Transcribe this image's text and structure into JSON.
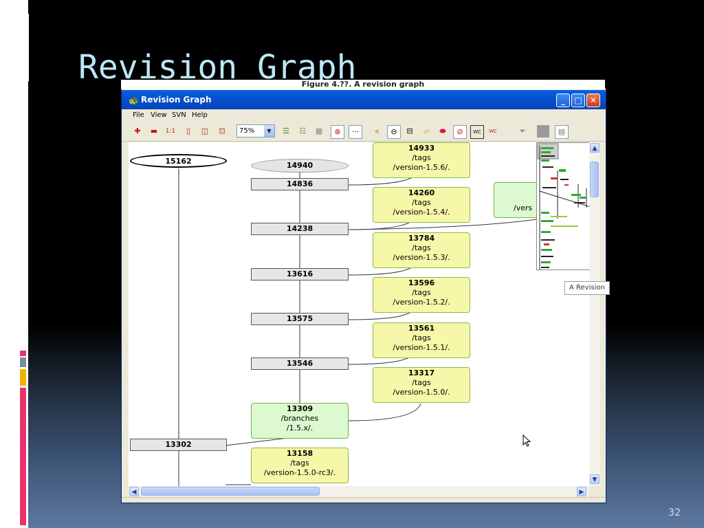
{
  "slide": {
    "title": "Revision Graph",
    "number": "32",
    "accent_colors": [
      "#e8336e",
      "#f0b400",
      "#3b6ab5"
    ]
  },
  "figure_caption": "Figure 4.??. A revision graph",
  "window": {
    "title": "Revision Graph",
    "menu": [
      "File",
      "View",
      "SVN",
      "Help"
    ],
    "zoom_value": "75%",
    "tooltip": "A Revision"
  },
  "graph": {
    "trunk_head": "15162",
    "branch_head": "14940",
    "revisions": [
      "14836",
      "14238",
      "13616",
      "13575",
      "13546",
      "13302"
    ],
    "tags": [
      {
        "rev": "14933",
        "path": "/tags",
        "name": "/version-1.5.6/."
      },
      {
        "rev": "14260",
        "path": "/tags",
        "name": "/version-1.5.4/."
      },
      {
        "rev": "13784",
        "path": "/tags",
        "name": "/version-1.5.3/."
      },
      {
        "rev": "13596",
        "path": "/tags",
        "name": "/version-1.5.2/."
      },
      {
        "rev": "13561",
        "path": "/tags",
        "name": "/version-1.5.1/."
      },
      {
        "rev": "13317",
        "path": "/tags",
        "name": "/version-1.5.0/."
      },
      {
        "rev": "13158",
        "path": "/tags",
        "name": "/version-1.5.0-rc3/."
      }
    ],
    "branch": {
      "rev": "13309",
      "path": "/branches",
      "name": "/1.5.x/."
    },
    "partial_node_text": "/vers"
  }
}
